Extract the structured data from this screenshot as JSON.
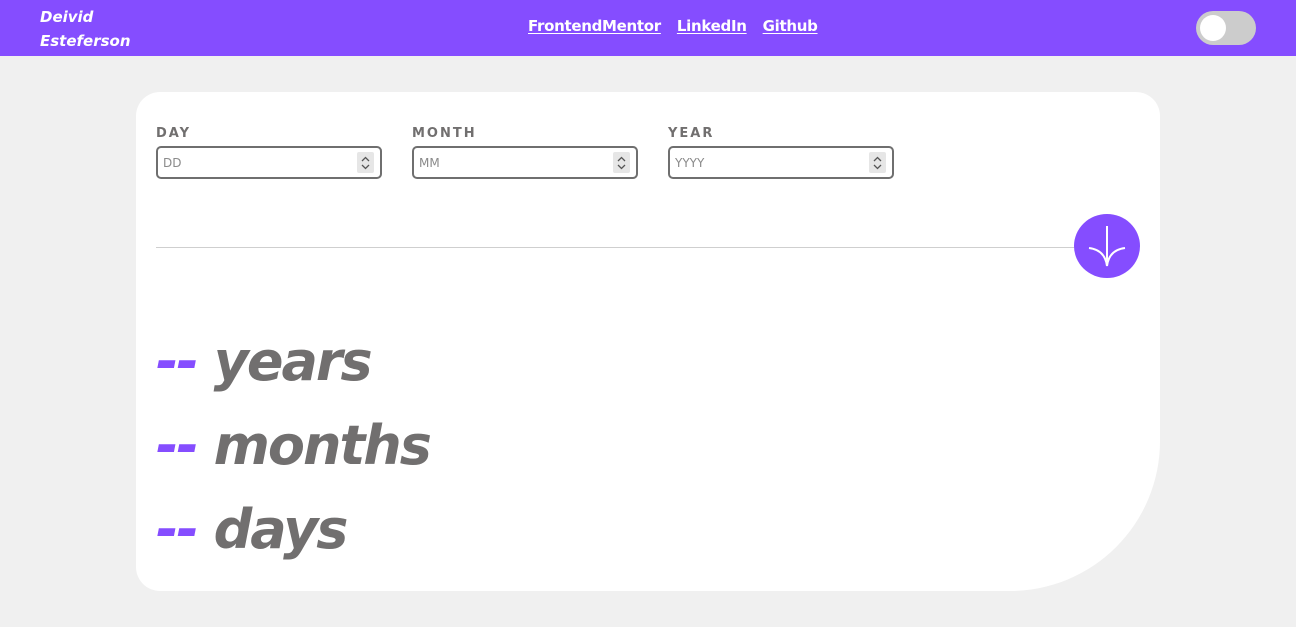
{
  "header": {
    "brand_line1": "Deivid",
    "brand_line2": "Esteferson",
    "links": [
      {
        "label": "FrontendMentor"
      },
      {
        "label": "LinkedIn"
      },
      {
        "label": "Github"
      }
    ],
    "theme_toggle": {
      "state": "off",
      "icon": "toggle-switch"
    }
  },
  "form": {
    "day": {
      "label": "DAY",
      "placeholder": "DD",
      "value": ""
    },
    "month": {
      "label": "MONTH",
      "placeholder": "MM",
      "value": ""
    },
    "year": {
      "label": "YEAR",
      "placeholder": "YYYY",
      "value": ""
    },
    "submit_icon": "arrow-down-icon"
  },
  "results": {
    "years": {
      "value": "--",
      "unit": "years"
    },
    "months": {
      "value": "--",
      "unit": "months"
    },
    "days": {
      "value": "--",
      "unit": "days"
    }
  },
  "colors": {
    "accent": "#854dff",
    "background": "#f0f0f0",
    "card": "#ffffff",
    "text_gray": "#716f6f"
  }
}
